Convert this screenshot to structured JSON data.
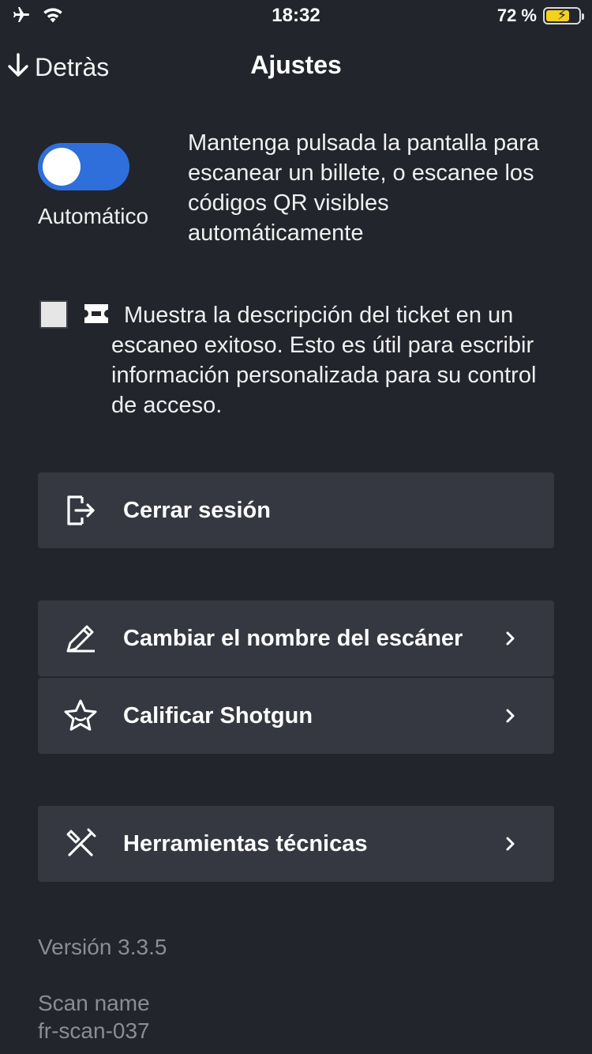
{
  "status_bar": {
    "time": "18:32",
    "battery_percent": "72 %",
    "battery_level": 0.72,
    "icons": [
      "airplane-icon",
      "wifi-icon",
      "battery-charging-icon"
    ]
  },
  "nav": {
    "back_label": "Detràs",
    "title": "Ajustes"
  },
  "auto_scan": {
    "enabled": true,
    "label": "Automático",
    "description": "Mantenga pulsada la pantalla para escanear un billete, o escanee los códigos QR visibles automáticamente"
  },
  "ticket_description": {
    "checked": false,
    "description": "Muestra la descripción del ticket en un escaneo exitoso. Esto es útil para escribir información personalizada para su control de acceso."
  },
  "menu": {
    "logout": "Cerrar sesión",
    "rename_scanner": "Cambiar el nombre del escáner",
    "rate_app": "Calificar Shotgun",
    "tech_tools": "Herramientas técnicas"
  },
  "footer": {
    "version": "Versión 3.3.5",
    "scan_name_label": "Scan name",
    "scan_name_value": "fr-scan-037"
  },
  "colors": {
    "background": "#22252c",
    "card": "#353840",
    "accent": "#2f6fdc",
    "muted_text": "#8a8d93",
    "battery": "#f4d21c"
  }
}
